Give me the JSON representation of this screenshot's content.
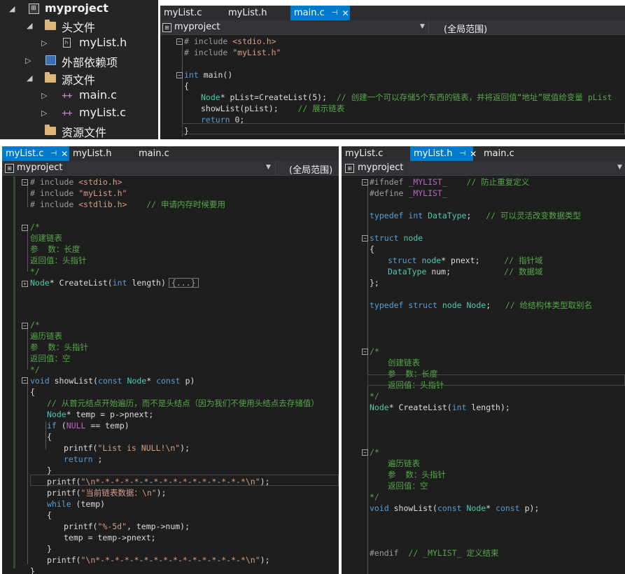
{
  "explorer": {
    "project": "myproject",
    "headers_folder": "头文件",
    "header_file": "myList.h",
    "deps_folder": "外部依赖项",
    "sources_folder": "源文件",
    "source_main": "main.c",
    "source_list": "myList.c",
    "resources_folder": "资源文件"
  },
  "top_editor": {
    "tabs": [
      "myList.c",
      "myList.h",
      "main.c"
    ],
    "active_tab": "main.c",
    "nav_project": "myproject",
    "nav_scope": "(全局范围)",
    "code": {
      "l1": "# include ",
      "l1s": "<stdio.h>",
      "l2": "# include ",
      "l2s": "\"myList.h\"",
      "l4k": "int",
      "l4": " main()",
      "l5": "{",
      "l6t": "Node",
      "l6": "* pList=CreateList(5);  ",
      "l6c": "// 创建一个可以存储5个东西的链表，并将返回值“地址”赋值给变量 pList",
      "l7": "showList(pList);    ",
      "l7c": "// 展示链表",
      "l8k": "return",
      "l8": " 0;",
      "l9": "}"
    }
  },
  "left_editor": {
    "tabs": [
      "myList.c",
      "myList.h",
      "main.c"
    ],
    "active_tab": "myList.c",
    "nav_project": "myproject",
    "nav_scope": "(全局范围)",
    "code": {
      "l1": "# include ",
      "l1s": "<stdio.h>",
      "l2": "# include ",
      "l2s": "\"myList.h\"",
      "l3": "# include ",
      "l3s": "<stdlib.h>",
      "l3c": "    // 申请内存时候要用",
      "c1a": "/*",
      "c1b": "创建链表",
      "c1c": "参  数：长度",
      "c1d": "返回值：头指针",
      "c1e": "*/",
      "fn1t": "Node",
      "fn1": "* CreateList(",
      "fn1k": "int",
      "fn1p": " length)",
      "fn1box": "{...}",
      "c2a": "/*",
      "c2b": "遍历链表",
      "c2c": "参  数：头指针",
      "c2d": "返回值：空",
      "c2e": "*/",
      "fn2k": "void",
      "fn2": " showList(",
      "fn2k2": "const",
      "fn2t": " Node",
      "fn2m": "* ",
      "fn2k3": "const",
      "fn2p": " p)",
      "b1": "{",
      "b2c": "// 从首元结点开始遍历，而不是头结点（因为我们不使用头结点去存储值）",
      "b3t": "Node",
      "b3": "* temp = p->pnext;",
      "b4k": "if",
      "b4": " (",
      "b4m": "NULL",
      "b4b": " == temp)",
      "b5": "{",
      "b6": "printf(",
      "b6s": "\"List is NULL!\\n\"",
      "b6e": ");",
      "b7k": "return",
      "b7": " ;",
      "b8": "}",
      "b9": "printf(",
      "b9s": "\"\\n*-*-*-*-*-*-*-*-*-*-*-*-*-*-*-*\\n\"",
      "b9e": ");",
      "b10": "printf(",
      "b10s": "\"当前链表数据：\\n\"",
      "b10e": ");",
      "b11k": "while",
      "b11": " (temp)",
      "b12": "{",
      "b13": "printf(",
      "b13s": "\"%-5d\"",
      "b13e": ", temp->num);",
      "b14": "temp = temp->pnext;",
      "b15": "}",
      "b16": "printf(",
      "b16s": "\"\\n*-*-*-*-*-*-*-*-*-*-*-*-*-*-*-*\\n\"",
      "b16e": ");",
      "b17": "}"
    }
  },
  "right_editor": {
    "tabs": [
      "myList.c",
      "myList.h",
      "main.c"
    ],
    "active_tab": "myList.h",
    "nav_project": "myproject",
    "code": {
      "l1p": "#ifndef ",
      "l1m": "_MYLIST_",
      "l1c": "    // 防止重复定义",
      "l2p": "#define ",
      "l2m": "_MYLIST_",
      "l4k": "typedef",
      "l4k2": " int",
      "l4t": " DataType",
      "l4": ";   ",
      "l4c": "// 可以灵活改变数据类型",
      "l6k": "struct",
      "l6t": " node",
      "l7": "{",
      "l8k": "struct",
      "l8t": " node",
      "l8": "* pnext;     ",
      "l8c": "// 指针域",
      "l9t": "DataType",
      "l9": " num;           ",
      "l9c": "// 数据域",
      "l10": "};",
      "l12k": "typedef",
      "l12k2": " struct",
      "l12t": " node",
      "l12t2": " Node",
      "l12": ";   ",
      "l12c": "// 给结构体类型取别名",
      "c1a": "/*",
      "c1b": "创建链表",
      "c1c": "参  数：长度",
      "c1d": "返回值：头指针",
      "c1e": "*/",
      "p1t": "Node",
      "p1": "* CreateList(",
      "p1k": "int",
      "p1e": " length);",
      "c2a": "/*",
      "c2b": "遍历链表",
      "c2c": "参  数：头指针",
      "c2d": "返回值：空",
      "c2e": "*/",
      "p2k": "void",
      "p2": " showList(",
      "p2k2": "const",
      "p2t": " Node",
      "p2m": "* ",
      "p2k3": "const",
      "p2e": " p);",
      "end": "#endif  ",
      "endc": "// _MYLIST_ 定义结束"
    }
  }
}
